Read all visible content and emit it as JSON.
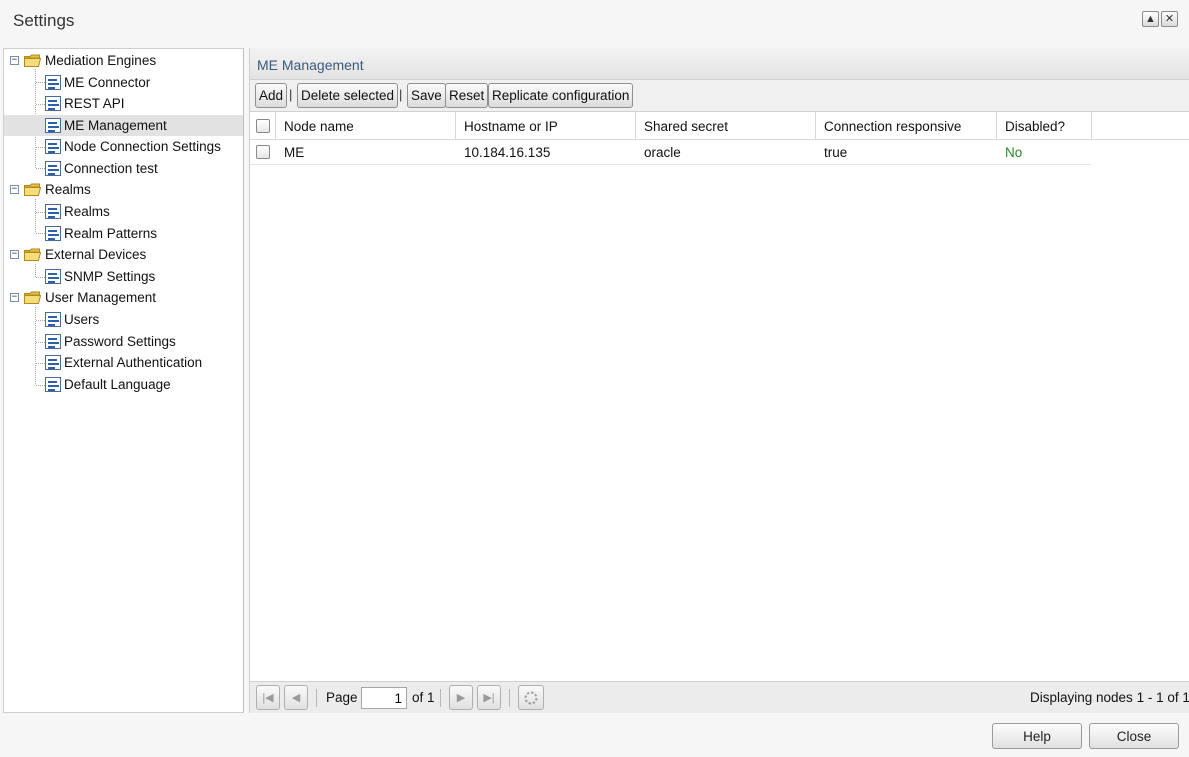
{
  "window": {
    "title": "Settings",
    "up_icon": "triangle-up-icon",
    "close_icon": "close-icon"
  },
  "tree": {
    "groups": [
      {
        "label": "Mediation Engines",
        "children": [
          "ME Connector",
          "REST API",
          "ME Management",
          "Node Connection Settings",
          "Connection test"
        ]
      },
      {
        "label": "Realms",
        "children": [
          "Realms",
          "Realm Patterns"
        ]
      },
      {
        "label": "External Devices",
        "children": [
          "SNMP Settings"
        ]
      },
      {
        "label": "User Management",
        "children": [
          "Users",
          "Password Settings",
          "External Authentication",
          "Default Language"
        ]
      }
    ],
    "selected": "ME Management"
  },
  "panel": {
    "title": "ME Management"
  },
  "toolbar": {
    "add": "Add",
    "sep1": "|",
    "delete_selected": "Delete selected",
    "sep2": "|",
    "save": "Save",
    "reset": "Reset",
    "replicate": "Replicate configuration"
  },
  "grid": {
    "columns": [
      "Node name",
      "Hostname or IP",
      "Shared secret",
      "Connection responsive",
      "Disabled?"
    ],
    "rows": [
      {
        "node_name": "ME",
        "hostname": "10.184.16.135",
        "secret": "oracle",
        "responsive": "true",
        "disabled": "No"
      }
    ],
    "disabled_color": "#2a8a2a"
  },
  "pager": {
    "page_label": "Page",
    "page_value": "1",
    "of_label": "of 1",
    "status": "Displaying nodes 1 - 1 of 1"
  },
  "footer": {
    "help": "Help",
    "close": "Close"
  }
}
